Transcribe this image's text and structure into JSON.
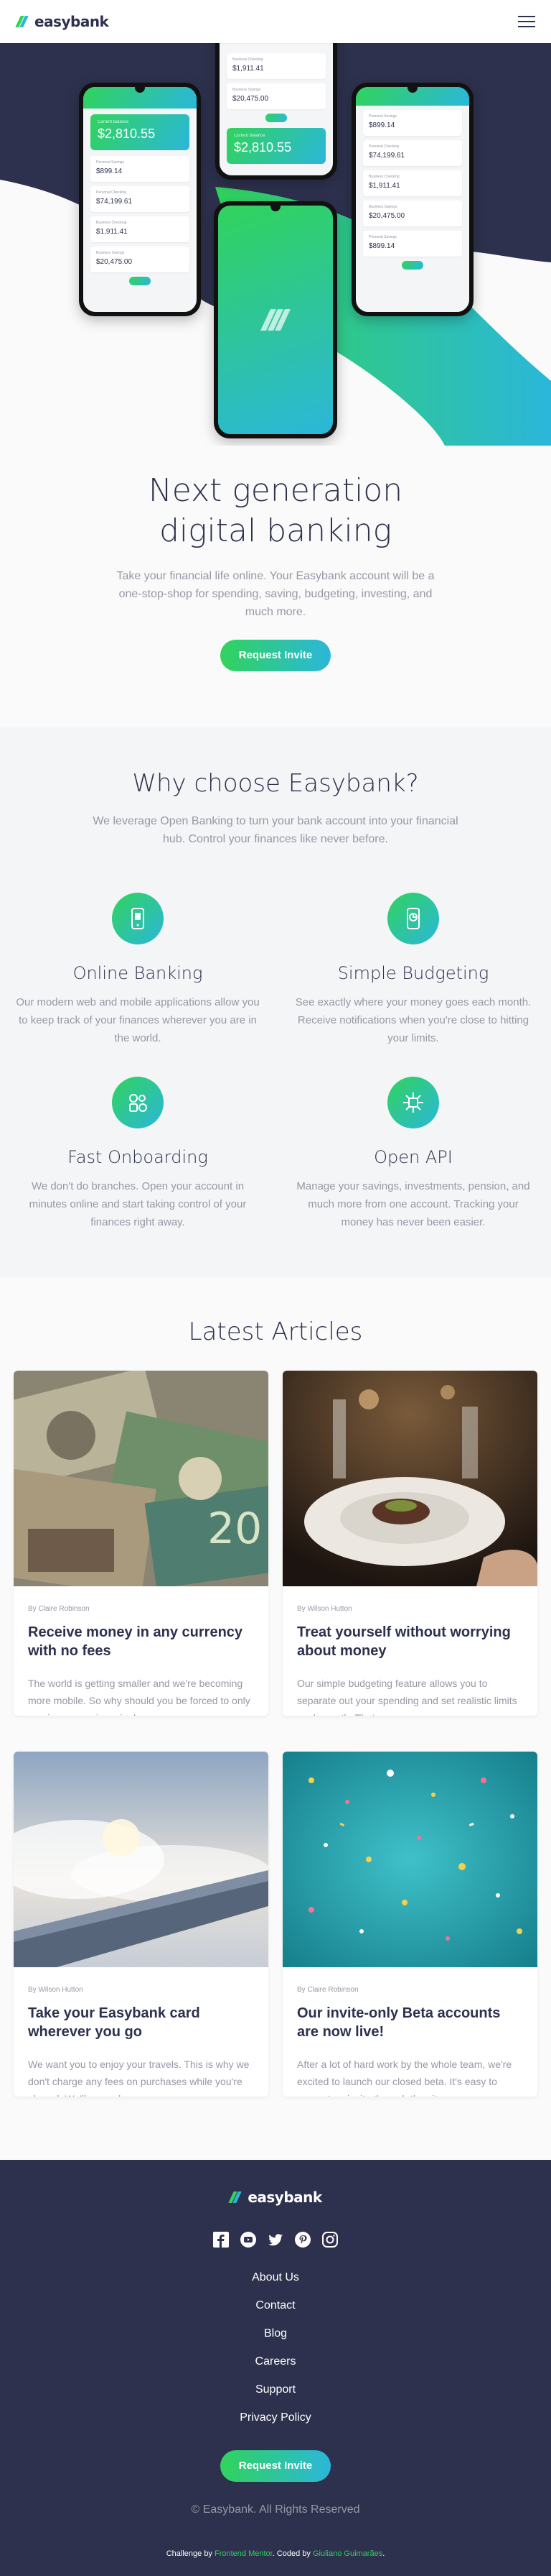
{
  "header": {
    "brand": "easybank",
    "menu_icon": "hamburger-icon"
  },
  "hero": {
    "title_line1": "Next generation",
    "title_line2": "digital banking",
    "description": "Take your financial life online. Your Easybank account will be a one-stop-shop for spending, saving, budgeting, investing, and much more.",
    "cta": "Request Invite",
    "phones": {
      "left": {
        "balance_label": "Current Balance",
        "balance": "$2,810.55",
        "accounts": [
          {
            "label": "Personal Savings",
            "amount": "$899.14"
          },
          {
            "label": "Personal Checking",
            "amount": "$74,199.61"
          },
          {
            "label": "Business Checking",
            "amount": "$1,911.41"
          },
          {
            "label": "Business Savings",
            "amount": "$20,475.00"
          }
        ]
      },
      "center_top": {
        "accounts": [
          {
            "label": "Business Checking",
            "amount": "$1,911.41"
          },
          {
            "label": "Business Savings",
            "amount": "$20,475.00"
          }
        ],
        "balance_label": "Current Balance",
        "balance": "$2,810.55"
      },
      "right": {
        "accounts": [
          {
            "label": "Personal Savings",
            "amount": "$899.14"
          },
          {
            "label": "Personal Checking",
            "amount": "$74,199.61"
          },
          {
            "label": "Business Checking",
            "amount": "$1,911.41"
          },
          {
            "label": "Business Savings",
            "amount": "$20,475.00"
          },
          {
            "label": "Personal Savings",
            "amount": "$899.14"
          }
        ]
      }
    }
  },
  "why": {
    "title": "Why choose Easybank?",
    "description": "We leverage Open Banking to turn your bank account into your financial hub. Control your finances like never before.",
    "features": [
      {
        "icon": "online-banking-icon",
        "title": "Online Banking",
        "text": "Our modern web and mobile applications allow you to keep track of your finances wherever you are in the world."
      },
      {
        "icon": "budgeting-icon",
        "title": "Simple Budgeting",
        "text": "See exactly where your money goes each month. Receive notifications when you're close to hitting your limits."
      },
      {
        "icon": "onboarding-icon",
        "title": "Fast Onboarding",
        "text": "We don't do branches. Open your account in minutes online and start taking control of your finances right away."
      },
      {
        "icon": "api-icon",
        "title": "Open API",
        "text": "Manage your savings, investments, pension, and much more from one account. Tracking your money has never been easier."
      }
    ]
  },
  "articles": {
    "title": "Latest Articles",
    "items": [
      {
        "author": "By Claire Robinson",
        "title": "Receive money in any currency with no fees",
        "excerpt": "The world is getting smaller and we're becoming more mobile. So why should you be forced to only receive money in a single …",
        "image": "currency-banknotes-photo"
      },
      {
        "author": "By Wilson Hutton",
        "title": "Treat yourself without worrying about money",
        "excerpt": "Our simple budgeting feature allows you to separate out your spending and set realistic limits each month. That means you …",
        "image": "restaurant-dinner-photo"
      },
      {
        "author": "By Wilson Hutton",
        "title": "Take your Easybank card wherever you go",
        "excerpt": "We want you to enjoy your travels. This is why we don't charge any fees on purchases while you're abroad. We'll even show you …",
        "image": "airplane-wing-photo"
      },
      {
        "author": "By Claire Robinson",
        "title": "Our invite-only Beta accounts are now live!",
        "excerpt": "After a lot of hard work by the whole team, we're excited to launch our closed beta. It's easy to request an invite through the site …",
        "image": "confetti-photo"
      }
    ]
  },
  "footer": {
    "brand": "easybank",
    "socials": [
      "facebook-icon",
      "youtube-icon",
      "twitter-icon",
      "pinterest-icon",
      "instagram-icon"
    ],
    "links": [
      "About Us",
      "Contact",
      "Blog",
      "Careers",
      "Support",
      "Privacy Policy"
    ],
    "cta": "Request Invite",
    "copyright": "© Easybank. All Rights Reserved",
    "attribution_prefix": "Challenge by",
    "attribution_fm": "Frontend Mentor",
    "attribution_mid": ". Coded by",
    "attribution_author": "Giuliano Guimarães",
    "attribution_suffix": "."
  },
  "colors": {
    "dark_blue": "#2d314d",
    "lime_green": "#31d35c",
    "bright_cyan": "#2bb7da",
    "grayish_blue": "#9698a6",
    "light_gray": "#f4f5f7"
  }
}
